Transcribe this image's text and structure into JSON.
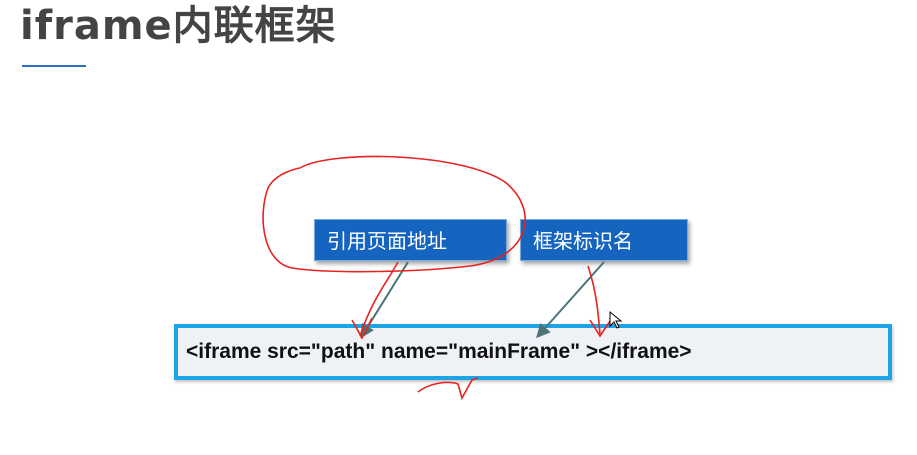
{
  "slide": {
    "title": "iframe内联框架"
  },
  "labels": {
    "src_label": "引用页面地址",
    "name_label": "框架标识名"
  },
  "code": {
    "line": "<iframe src=\"path\" name=\"mainFrame\" ></iframe>"
  },
  "colors": {
    "label_bg": "#1565c0",
    "code_border": "#1ea3e8",
    "annotation_ink": "#e8231f",
    "arrow": "#4a7477",
    "underline": "#2e6fc2"
  }
}
